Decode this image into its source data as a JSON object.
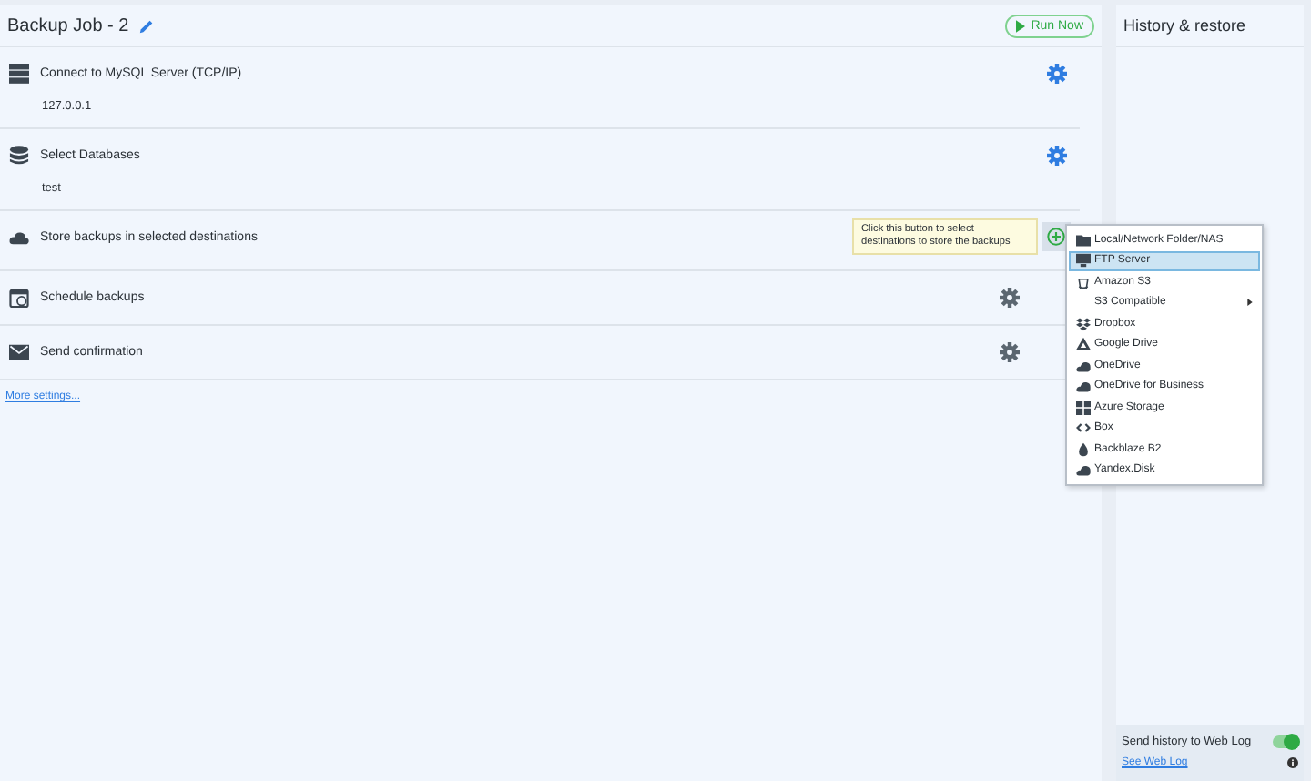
{
  "job": {
    "title": "Backup Job - 2",
    "run_button": "Run Now"
  },
  "sections": [
    {
      "title": "Connect to MySQL Server (TCP/IP)",
      "value": "127.0.0.1",
      "kind": "gear",
      "configured": true
    },
    {
      "title": "Select Databases",
      "value": "test",
      "kind": "gear",
      "configured": true
    },
    {
      "title": "Store backups in selected destinations",
      "kind": "add",
      "tooltip": "Click this button to select destinations to store the backups"
    },
    {
      "title": "Schedule backups",
      "kind": "gear",
      "configured": false
    },
    {
      "title": "Send confirmation",
      "kind": "gear",
      "configured": false
    }
  ],
  "more_settings": "More settings...",
  "destination_menu": [
    {
      "label": "Local/Network Folder/NAS",
      "selected": false,
      "submenu": false
    },
    {
      "label": "FTP Server",
      "selected": true,
      "submenu": false
    },
    {
      "label": "Amazon S3",
      "selected": false,
      "submenu": false
    },
    {
      "label": "S3 Compatible",
      "selected": false,
      "submenu": true
    },
    {
      "label": "Dropbox",
      "selected": false,
      "submenu": false
    },
    {
      "label": "Google Drive",
      "selected": false,
      "submenu": false
    },
    {
      "label": "OneDrive",
      "selected": false,
      "submenu": false
    },
    {
      "label": "OneDrive for Business",
      "selected": false,
      "submenu": false
    },
    {
      "label": "Azure Storage",
      "selected": false,
      "submenu": false
    },
    {
      "label": "Box",
      "selected": false,
      "submenu": false
    },
    {
      "label": "Backblaze B2",
      "selected": false,
      "submenu": false
    },
    {
      "label": "Yandex.Disk",
      "selected": false,
      "submenu": false
    }
  ],
  "history": {
    "title": "History & restore",
    "web_log_label": "Send history to Web Log",
    "web_log_on": true,
    "see_link": "See Web Log"
  }
}
